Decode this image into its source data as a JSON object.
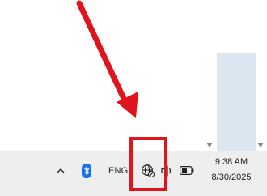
{
  "taskbar": {
    "language": "ENG",
    "clock": {
      "time": "9:38 AM",
      "date": "8/30/2025"
    }
  },
  "icons": {
    "tray_chevron": "chevron-up-icon",
    "bluetooth": "bluetooth-icon",
    "network": "globe-no-internet-icon",
    "volume": "speaker-icon",
    "battery": "battery-icon"
  },
  "annotation": {
    "color": "#e0151b",
    "shapes": [
      "arrow",
      "rectangle"
    ]
  },
  "colors": {
    "taskbar": "#eeeeee",
    "scroll_panel": "#dce6f0",
    "bluetooth": "#1a73e8"
  }
}
